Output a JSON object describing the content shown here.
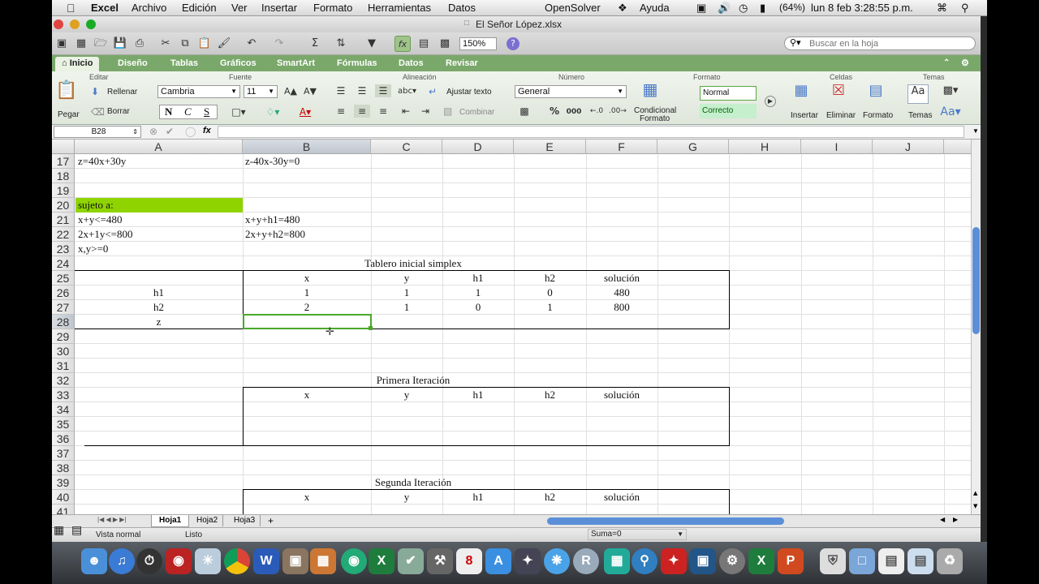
{
  "menubar": {
    "apple": "",
    "app": "Excel",
    "items": [
      "Archivo",
      "Edición",
      "Ver",
      "Insertar",
      "Formato",
      "Herramientas",
      "Datos",
      "OpenSolver",
      "Ayuda"
    ],
    "battery": "(64%)",
    "clock": "lun 8 feb  3:28:55 p.m."
  },
  "window": {
    "title": "El Señor López.xlsx"
  },
  "toolbar": {
    "zoom": "150%",
    "search_placeholder": "Buscar en la hoja"
  },
  "tabs": [
    "Inicio",
    "Diseño",
    "Tablas",
    "Gráficos",
    "SmartArt",
    "Fórmulas",
    "Datos",
    "Revisar"
  ],
  "ribbon": {
    "groups": [
      "Editar",
      "Fuente",
      "Alineación",
      "Número",
      "Formato",
      "Celdas",
      "Temas"
    ],
    "paste": "Pegar",
    "fill": "Rellenar",
    "clear": "Borrar",
    "font": "Cambria",
    "size": "11",
    "bold": "N",
    "italic": "C",
    "underline": "S",
    "wrap": "Ajustar texto",
    "merge": "Combinar",
    "numfmt": "General",
    "percent": "%",
    "thousands": "000",
    "cond1": "Condicional",
    "cond2": "Formato",
    "style_normal": "Normal",
    "style_good": "Correcto",
    "insert": "Insertar",
    "delete": "Eliminar",
    "format": "Formato",
    "themes": "Temas",
    "abc": "abc"
  },
  "formula": {
    "cellref": "B28",
    "fx": "fx",
    "value": ""
  },
  "columns": [
    "A",
    "B",
    "C",
    "D",
    "E",
    "F",
    "G",
    "H",
    "I",
    "J"
  ],
  "rows": [
    "17",
    "18",
    "19",
    "20",
    "21",
    "22",
    "23",
    "24",
    "25",
    "26",
    "27",
    "28",
    "29",
    "30",
    "31",
    "32",
    "33",
    "34",
    "35",
    "36",
    "37",
    "38",
    "39",
    "40",
    "41"
  ],
  "cells": {
    "a17": "z=40x+30y",
    "b17": "z-40x-30y=0",
    "a20": "sujeto a:",
    "a21": "x+y<=480",
    "b21": "x+y+h1=480",
    "a22": "2x+1y<=800",
    "b22": "2x+y+h2=800",
    "a23": "x,y>=0",
    "t24": "Tablero inicial simplex",
    "hdr": [
      "x",
      "y",
      "h1",
      "h2",
      "solución"
    ],
    "r26": {
      "label": "h1",
      "vals": [
        "1",
        "1",
        "1",
        "0",
        "480"
      ]
    },
    "r27": {
      "label": "h2",
      "vals": [
        "2",
        "1",
        "0",
        "1",
        "800"
      ]
    },
    "r28": {
      "label": "z"
    },
    "t32": "Primera Iteración",
    "t39": "Segunda Iteración"
  },
  "sheets": [
    "Hoja1",
    "Hoja2",
    "Hoja3"
  ],
  "status": {
    "view": "Vista normal",
    "ready": "Listo",
    "sum": "Suma=0"
  },
  "colors": {
    "highlight": "#8fd400",
    "selection": "#4aa82a",
    "tabs": "#7aa86a"
  }
}
